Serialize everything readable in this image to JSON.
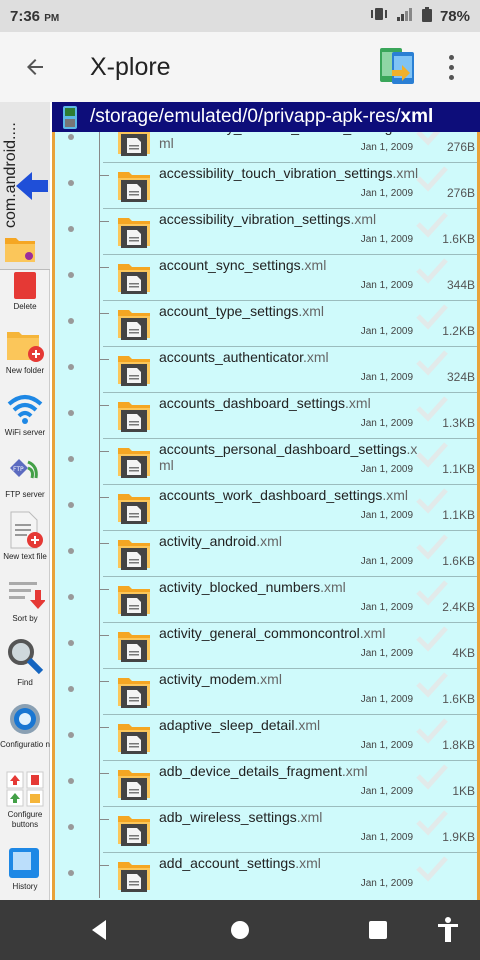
{
  "status": {
    "time": "7:36",
    "ampm": "PM",
    "battery": "78%"
  },
  "app": {
    "title": "X-plore"
  },
  "side": {
    "tab_label": "com.android....",
    "tools": [
      {
        "name": "delete",
        "label": "Delete"
      },
      {
        "name": "new-folder",
        "label": "New folder"
      },
      {
        "name": "wifi-server",
        "label": "WiFi server"
      },
      {
        "name": "ftp-server",
        "label": "FTP server"
      },
      {
        "name": "new-text-file",
        "label": "New text file"
      },
      {
        "name": "sort-by",
        "label": "Sort by"
      },
      {
        "name": "find",
        "label": "Find"
      },
      {
        "name": "configuration",
        "label": "Configuratio n"
      },
      {
        "name": "configure-buttons",
        "label": "Configure buttons"
      },
      {
        "name": "history",
        "label": "History"
      }
    ]
  },
  "path": {
    "prefix": "/storage/emulated/0/privapp-apk-res/",
    "current": "xml"
  },
  "files": [
    {
      "base": "accessibility_shortcut_service_settings",
      "ext": ".xml",
      "date": "Jan 1, 2009",
      "size": "276B"
    },
    {
      "base": "accessibility_touch_vibration_settings",
      "ext": ".xml",
      "date": "Jan 1, 2009",
      "size": "276B"
    },
    {
      "base": "accessibility_vibration_settings",
      "ext": ".xml",
      "date": "Jan 1, 2009",
      "size": "1.6KB"
    },
    {
      "base": "account_sync_settings",
      "ext": ".xml",
      "date": "Jan 1, 2009",
      "size": "344B"
    },
    {
      "base": "account_type_settings",
      "ext": ".xml",
      "date": "Jan 1, 2009",
      "size": "1.2KB"
    },
    {
      "base": "accounts_authenticator",
      "ext": ".xml",
      "date": "Jan 1, 2009",
      "size": "324B"
    },
    {
      "base": "accounts_dashboard_settings",
      "ext": ".xml",
      "date": "Jan 1, 2009",
      "size": "1.3KB"
    },
    {
      "base": "accounts_personal_dashboard_settings",
      "ext": ".xml",
      "date": "Jan 1, 2009",
      "size": "1.1KB"
    },
    {
      "base": "accounts_work_dashboard_settings",
      "ext": ".xml",
      "date": "Jan 1, 2009",
      "size": "1.1KB"
    },
    {
      "base": "activity_android",
      "ext": ".xml",
      "date": "Jan 1, 2009",
      "size": "1.6KB"
    },
    {
      "base": "activity_blocked_numbers",
      "ext": ".xml",
      "date": "Jan 1, 2009",
      "size": "2.4KB"
    },
    {
      "base": "activity_general_commoncontrol",
      "ext": ".xml",
      "date": "Jan 1, 2009",
      "size": "4KB"
    },
    {
      "base": "activity_modem",
      "ext": ".xml",
      "date": "Jan 1, 2009",
      "size": "1.6KB"
    },
    {
      "base": "adaptive_sleep_detail",
      "ext": ".xml",
      "date": "Jan 1, 2009",
      "size": "1.8KB"
    },
    {
      "base": "adb_device_details_fragment",
      "ext": ".xml",
      "date": "Jan 1, 2009",
      "size": "1KB"
    },
    {
      "base": "adb_wireless_settings",
      "ext": ".xml",
      "date": "Jan 1, 2009",
      "size": "1.9KB"
    },
    {
      "base": "add_account_settings",
      "ext": ".xml",
      "date": "Jan 1, 2009",
      "size": ""
    }
  ],
  "colors": {
    "path_bar": "#0d0d7a",
    "list_bg": "#cffafb",
    "accent_border": "#e8a23a",
    "nav_bar": "#3a3a3a"
  }
}
